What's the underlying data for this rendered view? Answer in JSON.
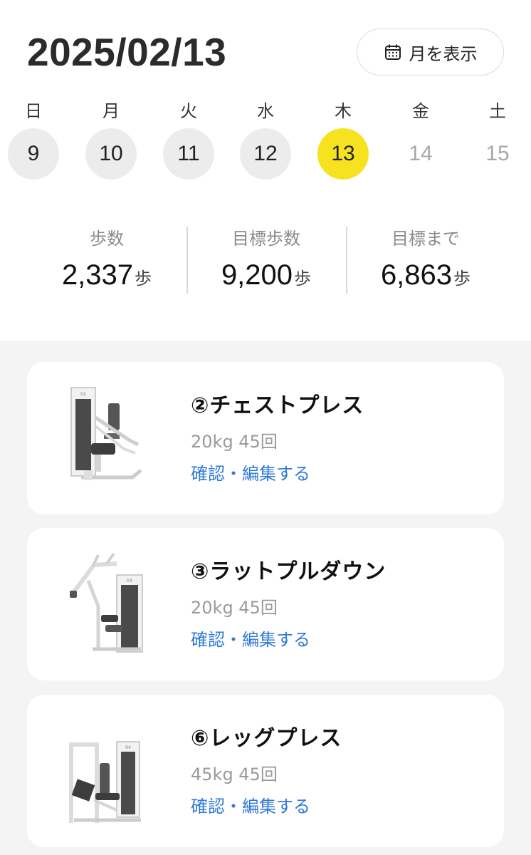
{
  "header": {
    "date": "2025/02/13",
    "month_button_label": "月を表示"
  },
  "week": [
    {
      "dow": "日",
      "day": "9",
      "state": "past"
    },
    {
      "dow": "月",
      "day": "10",
      "state": "past"
    },
    {
      "dow": "火",
      "day": "11",
      "state": "past"
    },
    {
      "dow": "水",
      "day": "12",
      "state": "past"
    },
    {
      "dow": "木",
      "day": "13",
      "state": "selected"
    },
    {
      "dow": "金",
      "day": "14",
      "state": "future"
    },
    {
      "dow": "土",
      "day": "15",
      "state": "future"
    }
  ],
  "stats": [
    {
      "label": "歩数",
      "value": "2,337",
      "unit": "歩"
    },
    {
      "label": "目標歩数",
      "value": "9,200",
      "unit": "歩"
    },
    {
      "label": "目標まで",
      "value": "6,863",
      "unit": "歩"
    }
  ],
  "workouts": [
    {
      "name": "②チェストプレス",
      "detail": "20kg 45回",
      "action": "確認・編集する",
      "icon": "chest-press-machine-icon"
    },
    {
      "name": "③ラットプルダウン",
      "detail": "20kg 45回",
      "action": "確認・編集する",
      "icon": "lat-pulldown-machine-icon"
    },
    {
      "name": "⑥レッグプレス",
      "detail": "45kg 45回",
      "action": "確認・編集する",
      "icon": "leg-press-machine-icon"
    }
  ],
  "colors": {
    "selected_day": "#f7e21f",
    "link": "#2f7ad8",
    "background": "#f4f4f4"
  }
}
